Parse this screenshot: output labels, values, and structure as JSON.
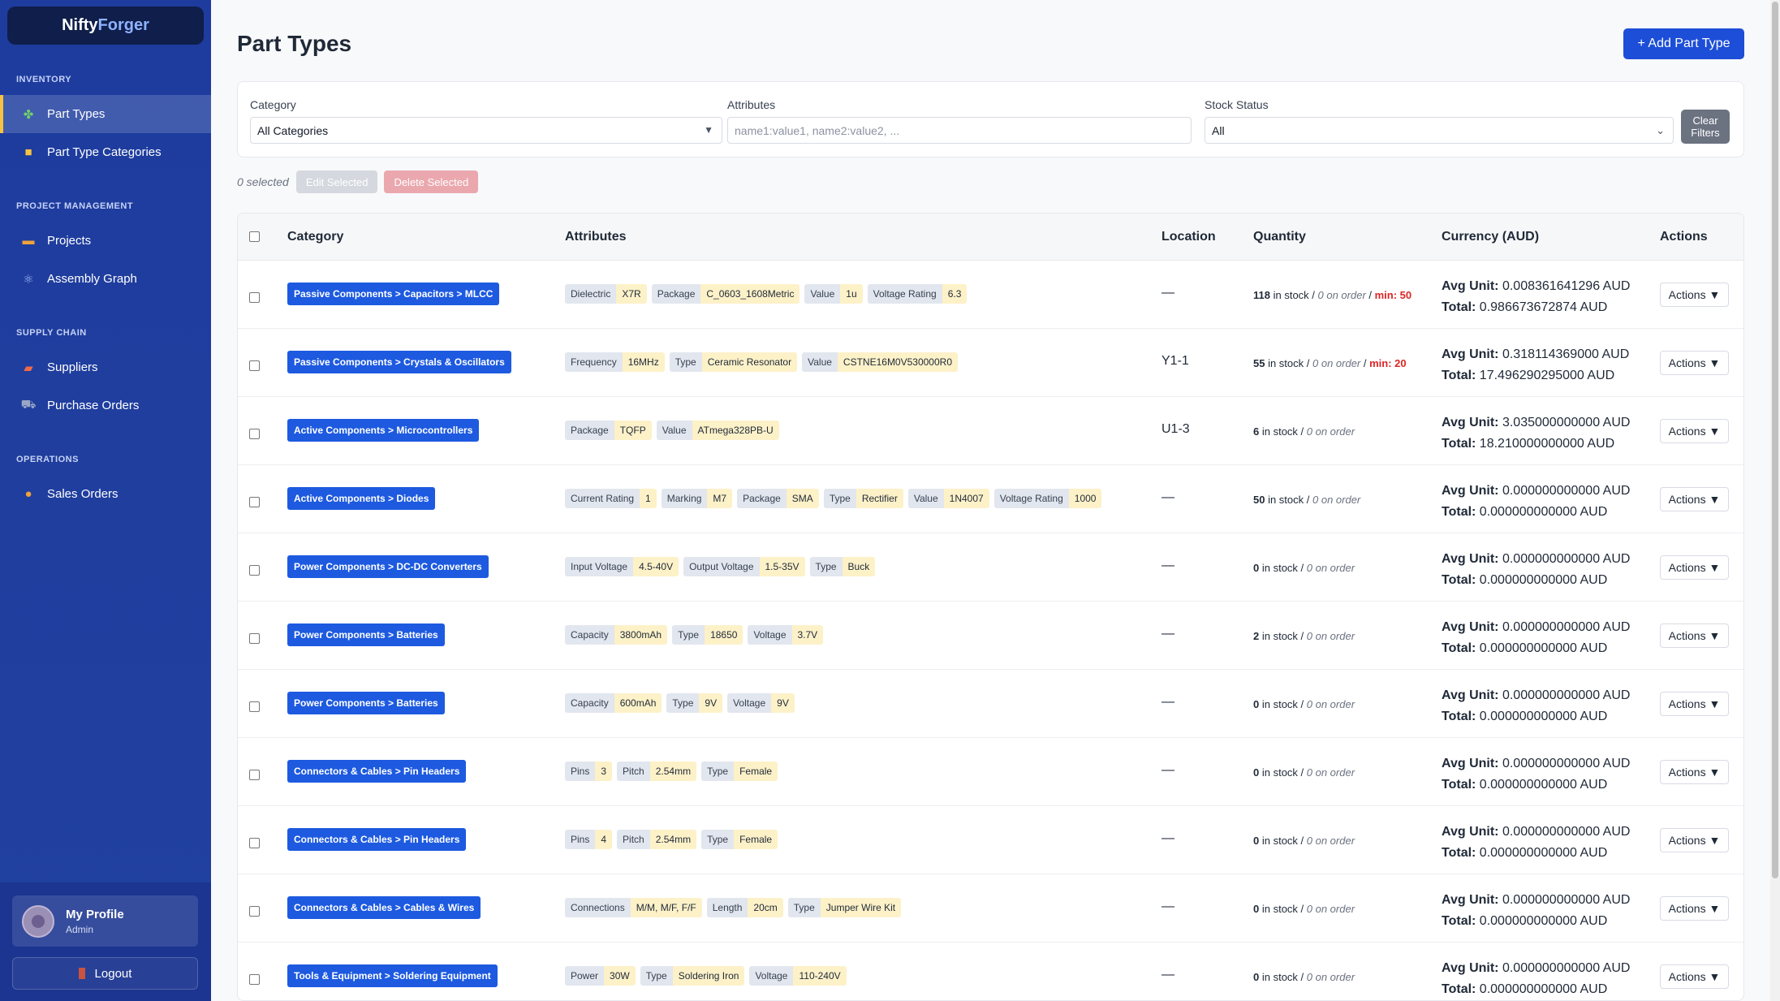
{
  "brand": {
    "part1": "Nifty",
    "part2": "Forger"
  },
  "sidebar": {
    "sections": [
      {
        "title": "INVENTORY",
        "items": [
          {
            "label": "Part Types",
            "icon": "puzzle-icon",
            "glyph": "✤",
            "color": "#6fd36a",
            "active": true
          },
          {
            "label": "Part Type Categories",
            "icon": "folder-icon",
            "glyph": "■",
            "color": "#f5c242",
            "active": false
          }
        ]
      },
      {
        "title": "PROJECT MANAGEMENT",
        "items": [
          {
            "label": "Projects",
            "icon": "briefcase-icon",
            "glyph": "▬",
            "color": "#f0a23a",
            "active": false
          },
          {
            "label": "Assembly Graph",
            "icon": "atom-icon",
            "glyph": "⚛",
            "color": "#9bb3f5",
            "active": false
          }
        ]
      },
      {
        "title": "SUPPLY CHAIN",
        "items": [
          {
            "label": "Suppliers",
            "icon": "truck-icon",
            "glyph": "▰",
            "color": "#ef6a4a",
            "active": false
          },
          {
            "label": "Purchase Orders",
            "icon": "cart-icon",
            "glyph": "⛟",
            "color": "#9aa6c6",
            "active": false
          }
        ]
      },
      {
        "title": "OPERATIONS",
        "items": [
          {
            "label": "Sales Orders",
            "icon": "money-bag-icon",
            "glyph": "●",
            "color": "#f0a23a",
            "active": false
          }
        ]
      }
    ],
    "profile": {
      "name": "My Profile",
      "role": "Admin"
    },
    "logout_label": "Logout"
  },
  "page": {
    "title": "Part Types",
    "add_button": "+ Add Part Type"
  },
  "filters": {
    "category_label": "Category",
    "category_value": "All Categories",
    "attributes_label": "Attributes",
    "attributes_placeholder": "name1:value1, name2:value2, ...",
    "stock_label": "Stock Status",
    "stock_value": "All",
    "clear_label_1": "Clear",
    "clear_label_2": "Filters"
  },
  "selection": {
    "count_text": "0 selected",
    "edit_label": "Edit Selected",
    "delete_label": "Delete Selected"
  },
  "table": {
    "headers": {
      "category": "Category",
      "attributes": "Attributes",
      "location": "Location",
      "quantity": "Quantity",
      "currency": "Currency (AUD)",
      "actions": "Actions"
    },
    "rows": [
      {
        "category": "Passive Components > Capacitors > MLCC",
        "attributes": [
          [
            "Dielectric",
            "X7R"
          ],
          [
            "Package",
            "C_0603_1608Metric"
          ],
          [
            "Value",
            "1u"
          ],
          [
            "Voltage Rating",
            "6.3"
          ]
        ],
        "location": "—",
        "stock": "118",
        "stock_text": " in stock / ",
        "on_order": "0 on order",
        "min_sep": " / ",
        "min": "min: 50",
        "avg_label": "Avg Unit:",
        "avg": " 0.008361641296 AUD",
        "total_label": "Total:",
        "total": " 0.986673672874 AUD",
        "actions": "Actions ▼"
      },
      {
        "category": "Passive Components > Crystals & Oscillators",
        "attributes": [
          [
            "Frequency",
            "16MHz"
          ],
          [
            "Type",
            "Ceramic Resonator"
          ],
          [
            "Value",
            "CSTNE16M0V530000R0"
          ]
        ],
        "location": "Y1-1",
        "stock": "55",
        "stock_text": " in stock / ",
        "on_order": "0 on order",
        "min_sep": " / ",
        "min": "min: 20",
        "avg_label": "Avg Unit:",
        "avg": " 0.318114369000 AUD",
        "total_label": "Total:",
        "total": " 17.496290295000 AUD",
        "actions": "Actions ▼"
      },
      {
        "category": "Active Components > Microcontrollers",
        "attributes": [
          [
            "Package",
            "TQFP"
          ],
          [
            "Value",
            "ATmega328PB-U"
          ]
        ],
        "location": "U1-3",
        "stock": "6",
        "stock_text": " in stock / ",
        "on_order": "0 on order",
        "min_sep": "",
        "min": "",
        "avg_label": "Avg Unit:",
        "avg": " 3.035000000000 AUD",
        "total_label": "Total:",
        "total": " 18.210000000000 AUD",
        "actions": "Actions ▼"
      },
      {
        "category": "Active Components > Diodes",
        "attributes": [
          [
            "Current Rating",
            "1"
          ],
          [
            "Marking",
            "M7"
          ],
          [
            "Package",
            "SMA"
          ],
          [
            "Type",
            "Rectifier"
          ],
          [
            "Value",
            "1N4007"
          ],
          [
            "Voltage Rating",
            "1000"
          ]
        ],
        "location": "—",
        "stock": "50",
        "stock_text": " in stock / ",
        "on_order": "0 on order",
        "min_sep": "",
        "min": "",
        "avg_label": "Avg Unit:",
        "avg": " 0.000000000000 AUD",
        "total_label": "Total:",
        "total": " 0.000000000000 AUD",
        "actions": "Actions ▼"
      },
      {
        "category": "Power Components > DC-DC Converters",
        "attributes": [
          [
            "Input Voltage",
            "4.5-40V"
          ],
          [
            "Output Voltage",
            "1.5-35V"
          ],
          [
            "Type",
            "Buck"
          ]
        ],
        "location": "—",
        "stock": "0",
        "stock_text": " in stock / ",
        "on_order": "0 on order",
        "min_sep": "",
        "min": "",
        "avg_label": "Avg Unit:",
        "avg": " 0.000000000000 AUD",
        "total_label": "Total:",
        "total": " 0.000000000000 AUD",
        "actions": "Actions ▼"
      },
      {
        "category": "Power Components > Batteries",
        "attributes": [
          [
            "Capacity",
            "3800mAh"
          ],
          [
            "Type",
            "18650"
          ],
          [
            "Voltage",
            "3.7V"
          ]
        ],
        "location": "—",
        "stock": "2",
        "stock_text": " in stock / ",
        "on_order": "0 on order",
        "min_sep": "",
        "min": "",
        "avg_label": "Avg Unit:",
        "avg": " 0.000000000000 AUD",
        "total_label": "Total:",
        "total": " 0.000000000000 AUD",
        "actions": "Actions ▼"
      },
      {
        "category": "Power Components > Batteries",
        "attributes": [
          [
            "Capacity",
            "600mAh"
          ],
          [
            "Type",
            "9V"
          ],
          [
            "Voltage",
            "9V"
          ]
        ],
        "location": "—",
        "stock": "0",
        "stock_text": " in stock / ",
        "on_order": "0 on order",
        "min_sep": "",
        "min": "",
        "avg_label": "Avg Unit:",
        "avg": " 0.000000000000 AUD",
        "total_label": "Total:",
        "total": " 0.000000000000 AUD",
        "actions": "Actions ▼"
      },
      {
        "category": "Connectors & Cables > Pin Headers",
        "attributes": [
          [
            "Pins",
            "3"
          ],
          [
            "Pitch",
            "2.54mm"
          ],
          [
            "Type",
            "Female"
          ]
        ],
        "location": "—",
        "stock": "0",
        "stock_text": " in stock / ",
        "on_order": "0 on order",
        "min_sep": "",
        "min": "",
        "avg_label": "Avg Unit:",
        "avg": " 0.000000000000 AUD",
        "total_label": "Total:",
        "total": " 0.000000000000 AUD",
        "actions": "Actions ▼"
      },
      {
        "category": "Connectors & Cables > Pin Headers",
        "attributes": [
          [
            "Pins",
            "4"
          ],
          [
            "Pitch",
            "2.54mm"
          ],
          [
            "Type",
            "Female"
          ]
        ],
        "location": "—",
        "stock": "0",
        "stock_text": " in stock / ",
        "on_order": "0 on order",
        "min_sep": "",
        "min": "",
        "avg_label": "Avg Unit:",
        "avg": " 0.000000000000 AUD",
        "total_label": "Total:",
        "total": " 0.000000000000 AUD",
        "actions": "Actions ▼"
      },
      {
        "category": "Connectors & Cables > Cables & Wires",
        "attributes": [
          [
            "Connections",
            "M/M, M/F, F/F"
          ],
          [
            "Length",
            "20cm"
          ],
          [
            "Type",
            "Jumper Wire Kit"
          ]
        ],
        "location": "—",
        "stock": "0",
        "stock_text": " in stock / ",
        "on_order": "0 on order",
        "min_sep": "",
        "min": "",
        "avg_label": "Avg Unit:",
        "avg": " 0.000000000000 AUD",
        "total_label": "Total:",
        "total": " 0.000000000000 AUD",
        "actions": "Actions ▼"
      },
      {
        "category": "Tools & Equipment > Soldering Equipment",
        "attributes": [
          [
            "Power",
            "30W"
          ],
          [
            "Type",
            "Soldering Iron"
          ],
          [
            "Voltage",
            "110-240V"
          ]
        ],
        "location": "—",
        "stock": "0",
        "stock_text": " in stock / ",
        "on_order": "0 on order",
        "min_sep": "",
        "min": "",
        "avg_label": "Avg Unit:",
        "avg": " 0.000000000000 AUD",
        "total_label": "Total:",
        "total": " 0.000000000000 AUD",
        "actions": "Actions ▼"
      }
    ]
  }
}
